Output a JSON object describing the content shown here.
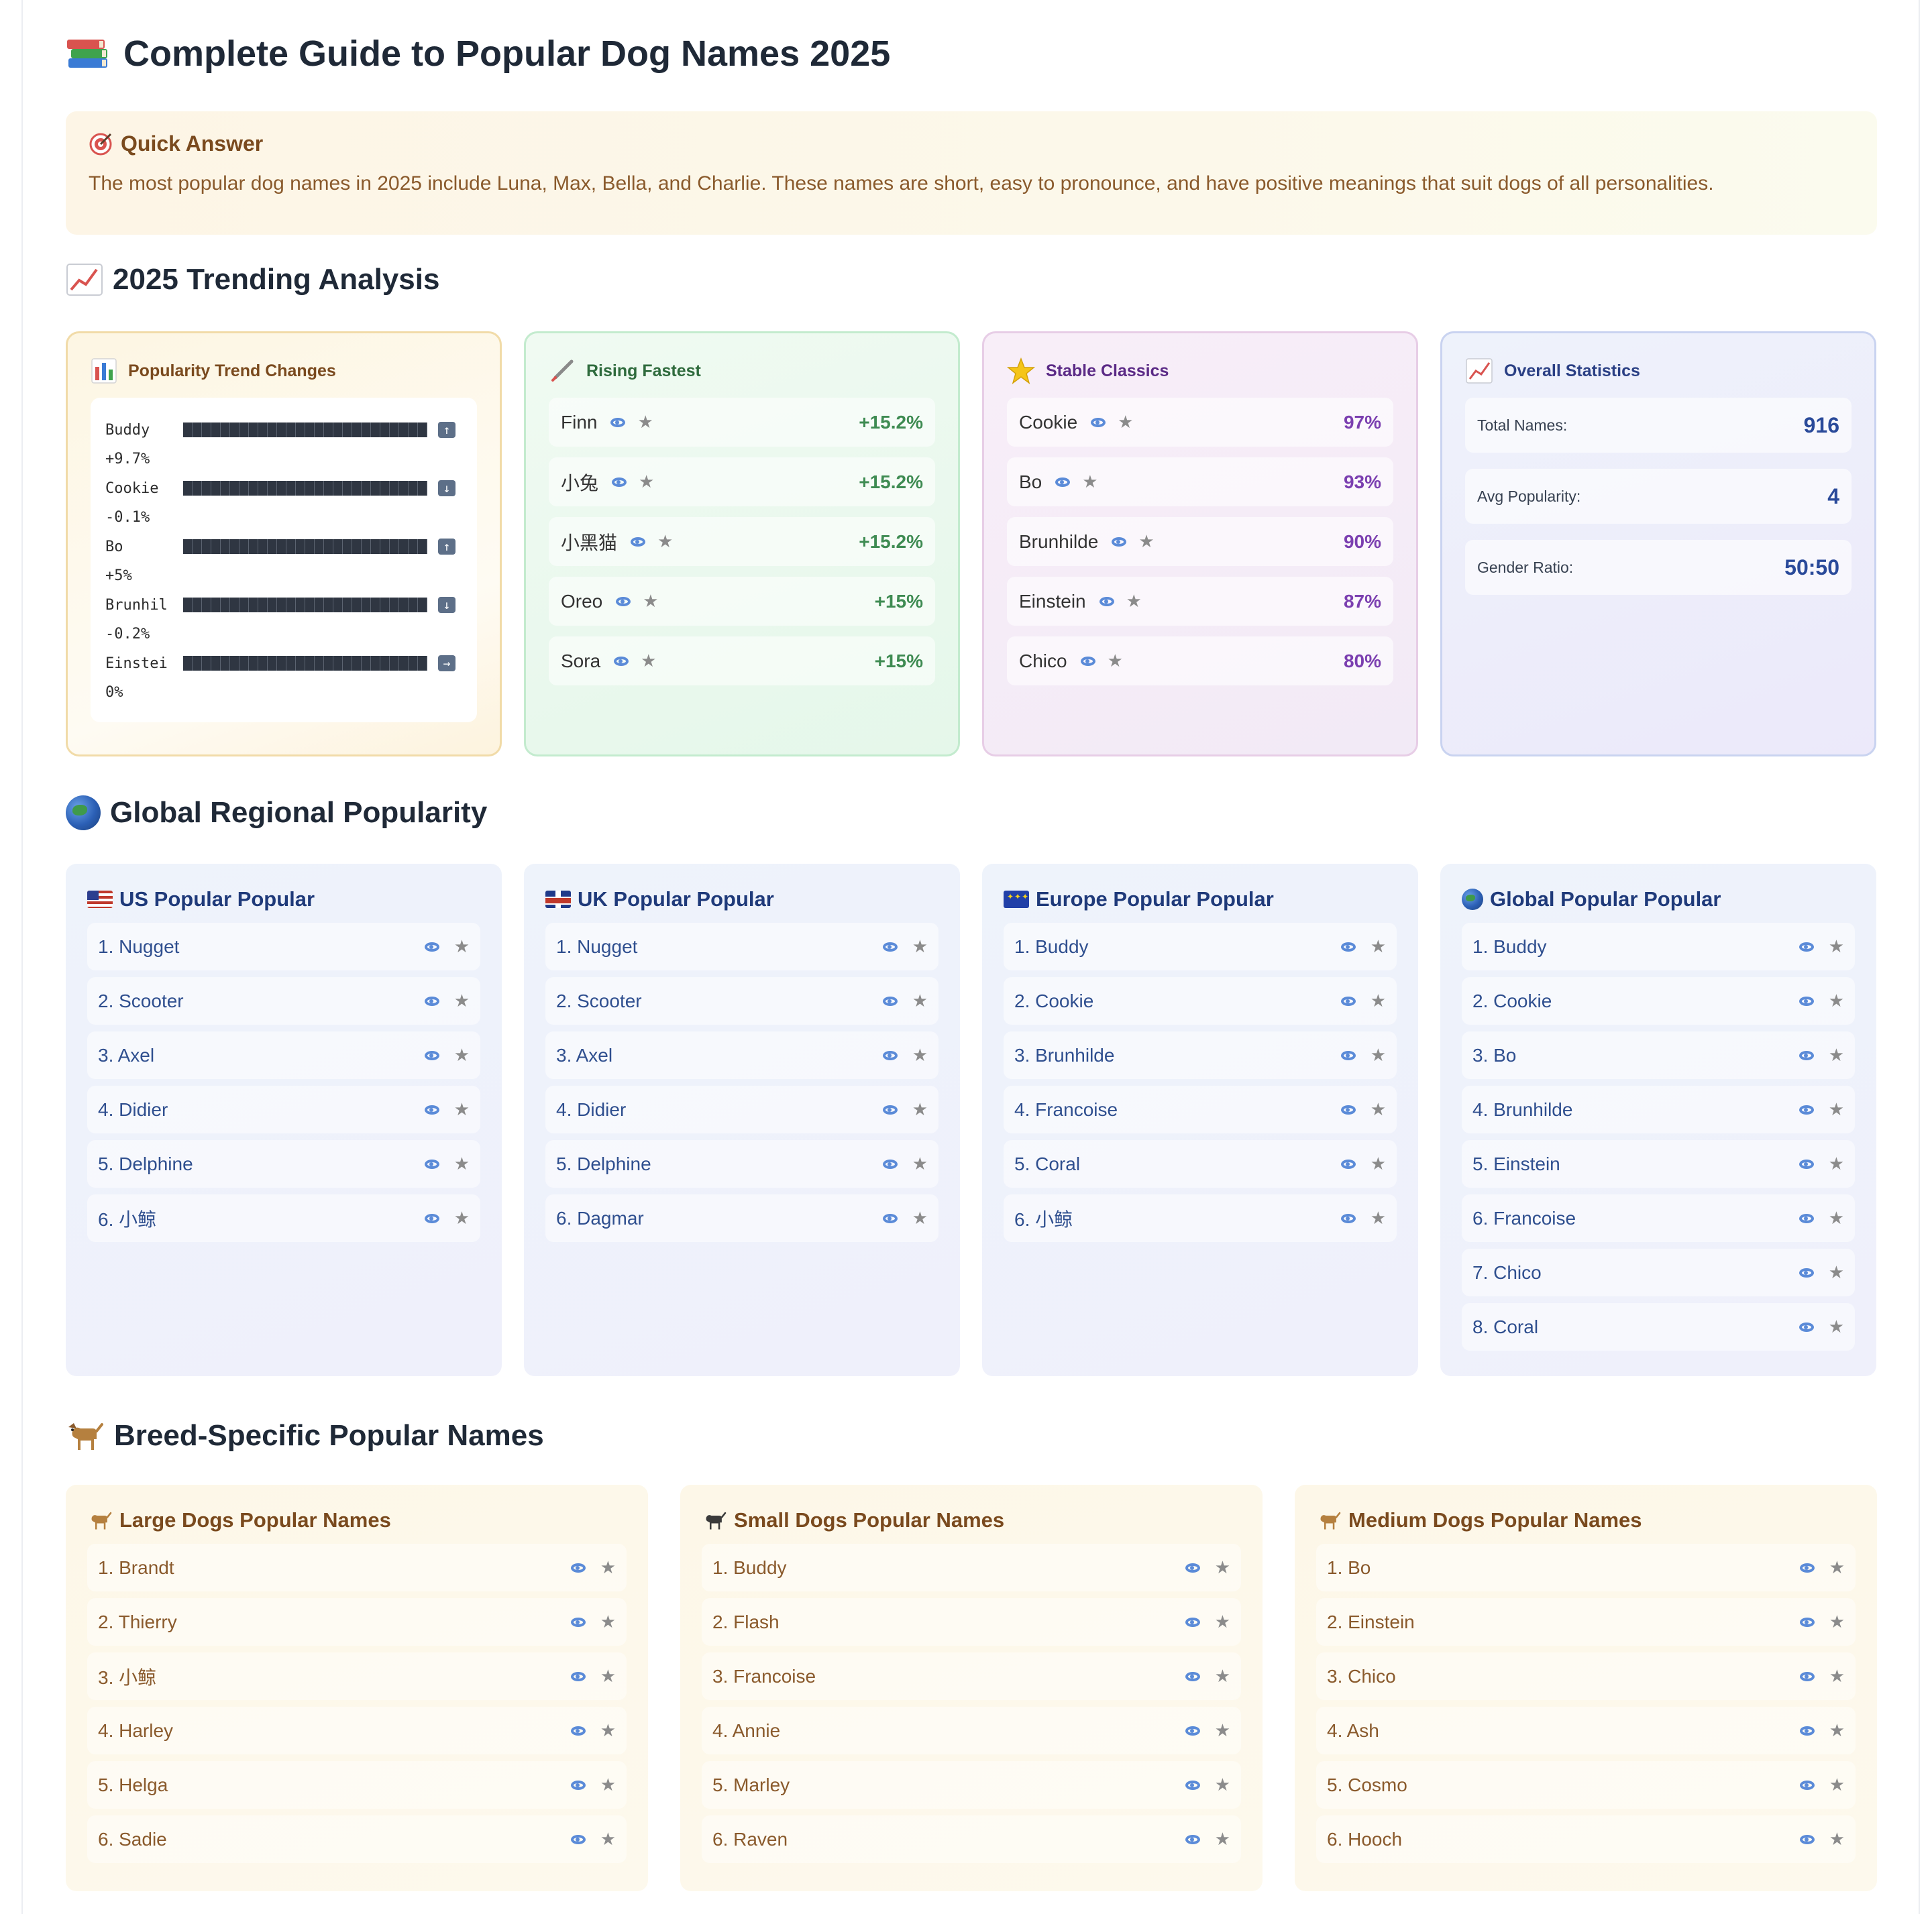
{
  "page_title": "Complete Guide to Popular Dog Names 2025",
  "quick_answer": {
    "title": "Quick Answer",
    "text": "The most popular dog names in 2025 include Luna, Max, Bella, and Charlie. These names are short, easy to pronounce, and have positive meanings that suit dogs of all personalities."
  },
  "sections": {
    "trending": "2025 Trending Analysis",
    "regional": "Global Regional Popularity",
    "breed": "Breed-Specific Popular Names"
  },
  "trend_card": {
    "title": "Popularity Trend Changes",
    "rows": [
      {
        "name": "Buddy",
        "change": "+9.7%",
        "direction": "up"
      },
      {
        "name": "Cookie",
        "change": "-0.1%",
        "direction": "down"
      },
      {
        "name": "Bo",
        "change": "+5%",
        "direction": "up"
      },
      {
        "name": "Brunhil",
        "change": "-0.2%",
        "direction": "down"
      },
      {
        "name": "Einstei",
        "change": "0%",
        "direction": "right"
      }
    ]
  },
  "rising_card": {
    "title": "Rising Fastest",
    "rows": [
      {
        "name": "Finn",
        "value": "+15.2%"
      },
      {
        "name": "小兔",
        "value": "+15.2%"
      },
      {
        "name": "小黑猫",
        "value": "+15.2%"
      },
      {
        "name": "Oreo",
        "value": "+15%"
      },
      {
        "name": "Sora",
        "value": "+15%"
      }
    ]
  },
  "stable_card": {
    "title": "Stable Classics",
    "rows": [
      {
        "name": "Cookie",
        "value": "97%"
      },
      {
        "name": "Bo",
        "value": "93%"
      },
      {
        "name": "Brunhilde",
        "value": "90%"
      },
      {
        "name": "Einstein",
        "value": "87%"
      },
      {
        "name": "Chico",
        "value": "80%"
      }
    ]
  },
  "stats_card": {
    "title": "Overall Statistics",
    "rows": [
      {
        "label": "Total Names:",
        "value": "916"
      },
      {
        "label": "Avg Popularity:",
        "value": "4"
      },
      {
        "label": "Gender Ratio:",
        "value": "50:50"
      }
    ]
  },
  "regions": [
    {
      "title": "US Popular Popular",
      "flag": "us-flag-icon",
      "names": [
        "1. Nugget",
        "2. Scooter",
        "3. Axel",
        "4. Didier",
        "5. Delphine",
        "6. 小鲸"
      ]
    },
    {
      "title": "UK Popular Popular",
      "flag": "uk-flag-icon",
      "names": [
        "1. Nugget",
        "2. Scooter",
        "3. Axel",
        "4. Didier",
        "5. Delphine",
        "6. Dagmar"
      ]
    },
    {
      "title": "Europe Popular Popular",
      "flag": "eu-flag-icon",
      "names": [
        "1. Buddy",
        "2. Cookie",
        "3. Brunhilde",
        "4. Francoise",
        "5. Coral",
        "6. 小鲸"
      ]
    },
    {
      "title": "Global Popular Popular",
      "flag": "globe-icon",
      "names": [
        "1. Buddy",
        "2. Cookie",
        "3. Bo",
        "4. Brunhilde",
        "5. Einstein",
        "6. Francoise",
        "7. Chico",
        "8. Coral"
      ]
    }
  ],
  "breeds": [
    {
      "title": "Large Dogs Popular Names",
      "names": [
        "1. Brandt",
        "2. Thierry",
        "3. 小鲸",
        "4. Harley",
        "5. Helga",
        "6. Sadie"
      ]
    },
    {
      "title": "Small Dogs Popular Names",
      "names": [
        "1. Buddy",
        "2. Flash",
        "3. Francoise",
        "4. Annie",
        "5. Marley",
        "6. Raven"
      ]
    },
    {
      "title": "Medium Dogs Popular Names",
      "names": [
        "1. Bo",
        "2. Einstein",
        "3. Chico",
        "4. Ash",
        "5. Cosmo",
        "6. Hooch"
      ]
    }
  ]
}
